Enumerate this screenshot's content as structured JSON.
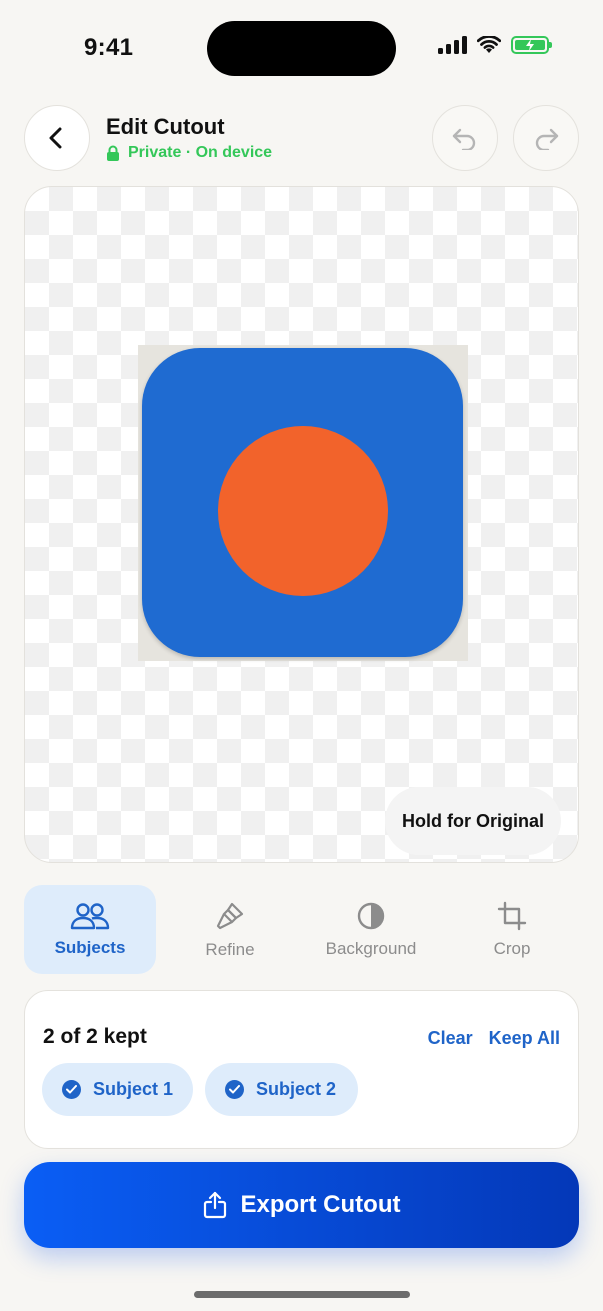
{
  "status_bar": {
    "time": "9:41"
  },
  "header": {
    "title": "Edit Cutout",
    "subtitle": "Private · On device"
  },
  "canvas": {
    "hold_label": "Hold for Original"
  },
  "tabs": [
    {
      "label": "Subjects",
      "icon": "people-icon",
      "active": true
    },
    {
      "label": "Refine",
      "icon": "brush-icon",
      "active": false
    },
    {
      "label": "Background",
      "icon": "half-circle-icon",
      "active": false
    },
    {
      "label": "Crop",
      "icon": "crop-icon",
      "active": false
    }
  ],
  "subjects_panel": {
    "title": "2 of 2 kept",
    "clear_label": "Clear",
    "keep_all_label": "Keep All",
    "chips": [
      {
        "label": "Subject 1",
        "checked": true
      },
      {
        "label": "Subject 2",
        "checked": true
      }
    ]
  },
  "export": {
    "label": "Export Cutout"
  },
  "colors": {
    "accent": "#1f64c8",
    "private_green": "#34c759",
    "subject_blue": "#1f6bd1",
    "subject_orange": "#f2632b",
    "export_start": "#0a5ef5",
    "export_end": "#0438b8"
  }
}
